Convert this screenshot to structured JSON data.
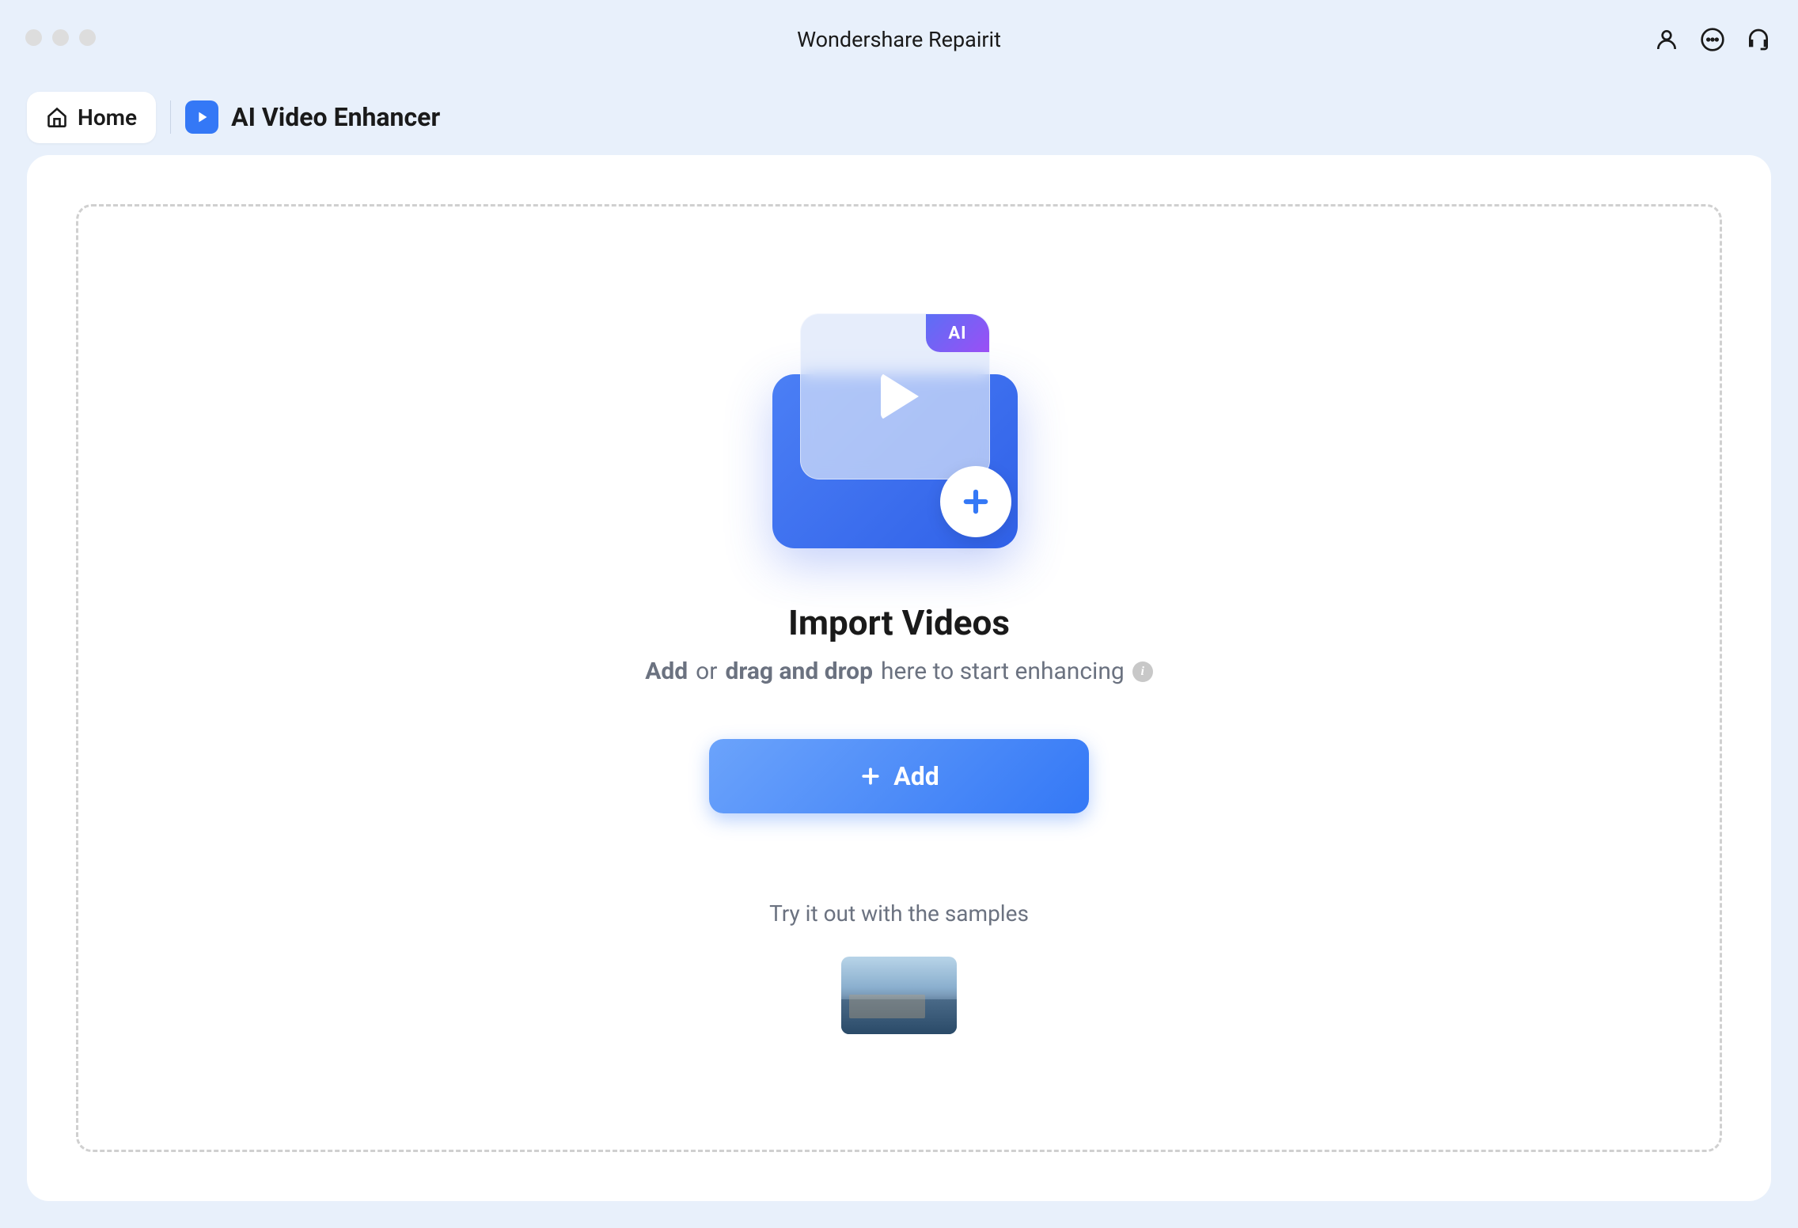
{
  "titlebar": {
    "app_name": "Wondershare Repairit"
  },
  "breadcrumb": {
    "home_label": "Home",
    "current_page": "AI Video Enhancer",
    "ai_badge": "AI"
  },
  "import": {
    "title": "Import Videos",
    "subtitle_add": "Add",
    "subtitle_or": "or",
    "subtitle_drag": "drag and drop",
    "subtitle_rest": "here to start enhancing",
    "add_button": "Add",
    "samples_label": "Try it out with the samples"
  }
}
